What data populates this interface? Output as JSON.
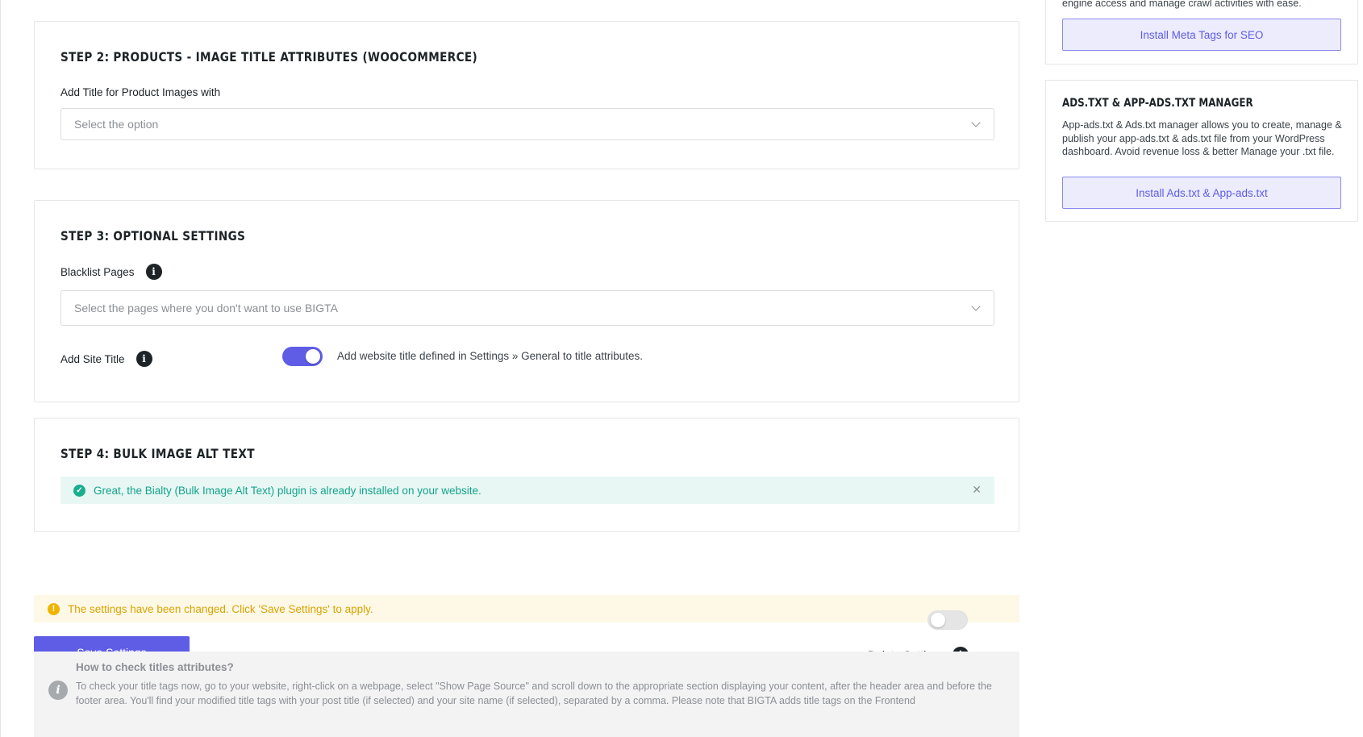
{
  "step2": {
    "title": "STEP 2: PRODUCTS - IMAGE TITLE ATTRIBUTES (WOOCOMMERCE)",
    "field_label": "Add Title for Product Images with",
    "select_placeholder": "Select the option"
  },
  "step3": {
    "title": "STEP 3: OPTIONAL SETTINGS",
    "blacklist_label": "Blacklist Pages",
    "blacklist_placeholder": "Select the pages where you don't want to use BIGTA",
    "site_title_label": "Add Site Title",
    "site_title_enabled": true,
    "site_title_description": "Add website title defined in Settings » General to title attributes."
  },
  "step4": {
    "title": "STEP 4: BULK IMAGE ALT TEXT",
    "success_message": "Great, the Bialty (Bulk Image Alt Text) plugin is already installed on your website."
  },
  "notice": {
    "warning_message": "The settings have been changed. Click 'Save Settings' to apply."
  },
  "actions": {
    "save_label": "Save Settings",
    "delete_label": "Delete Settings",
    "delete_enabled": false
  },
  "help": {
    "title": "How to check titles attributes?",
    "text": "To check your title tags now, go to your website, right-click on a webpage, select \"Show Page Source\" and scroll down to the appropriate section displaying your content, after the header area and before the footer area. You'll find your modified title tags with your post title (if selected) and your site name (if selected), separated by a comma. Please note that BIGTA adds title tags on the Frontend"
  },
  "sidebar": {
    "meta_tags": {
      "text_tail": "engine access and manage crawl activities with ease.",
      "button_label": "Install Meta Tags for SEO"
    },
    "ads_txt": {
      "title": "ADS.TXT & APP-ADS.TXT MANAGER",
      "text": "App-ads.txt & Ads.txt manager allows you to create, manage & publish your app-ads.txt & ads.txt file from your WordPress dashboard. Avoid revenue loss & better Manage your .txt file.",
      "button_label": "Install Ads.txt & App-ads.txt"
    }
  },
  "colors": {
    "accent": "#5f5ce6",
    "success": "#1aae8f",
    "warning": "#f0b400"
  }
}
